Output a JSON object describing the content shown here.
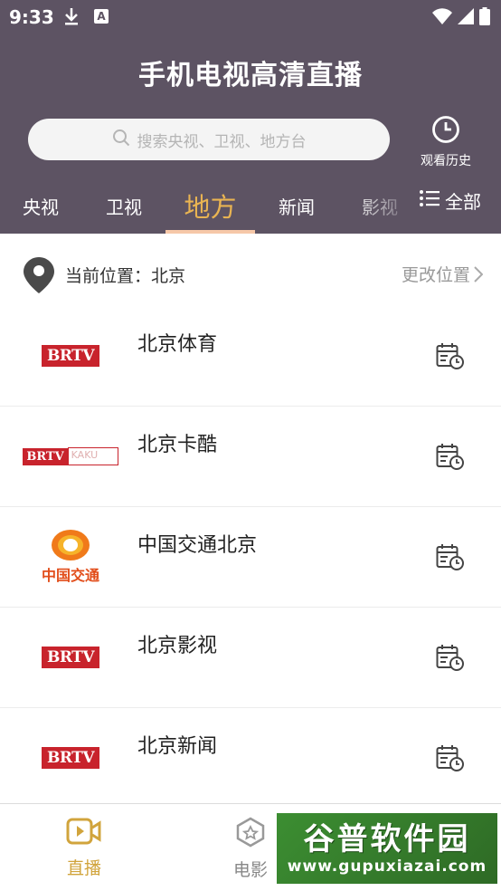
{
  "status_bar": {
    "time": "9:33",
    "icon_a": "A"
  },
  "header": {
    "title": "手机电视高清直播",
    "search_placeholder": "搜索央视、卫视、地方台",
    "history_label": "观看历史"
  },
  "tabs": {
    "items": [
      {
        "label": "央视",
        "active": false
      },
      {
        "label": "卫视",
        "active": false
      },
      {
        "label": "地方",
        "active": true
      },
      {
        "label": "新闻",
        "active": false
      },
      {
        "label": "影视",
        "active": false
      }
    ],
    "all_label": "全部"
  },
  "location": {
    "current_label": "当前位置：北京",
    "change_label": "更改位置"
  },
  "channels": [
    {
      "name": "北京体育",
      "logo_text": "BRTV"
    },
    {
      "name": "北京卡酷",
      "logo_text": "BRTV",
      "logo_sub": "KAKU"
    },
    {
      "name": "中国交通北京",
      "logo_text": "中国交通"
    },
    {
      "name": "北京影视",
      "logo_text": "BRTV"
    },
    {
      "name": "北京新闻",
      "logo_text": "BRTV"
    }
  ],
  "bottom_nav": {
    "live_label": "直播",
    "movie_label": "电影"
  },
  "watermark": {
    "main": "谷普软件园",
    "url": "www.gupuxiazai.com"
  },
  "colors": {
    "header_bg": "#5d5363",
    "accent": "#e9b452",
    "brtv_red": "#c8232c"
  }
}
